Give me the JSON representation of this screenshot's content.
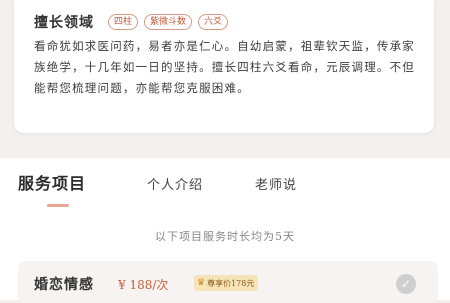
{
  "profile": {
    "expertise_title": "擅长领域",
    "tags": [
      "四柱",
      "紫微斗数",
      "六爻"
    ],
    "bio": "看命犹如求医问药，易者亦是仁心。自幼启蒙，祖辈钦天监，传承家族绝学，十几年如一日的坚持。擅长四柱六爻看命，元辰调理。不但能帮您梳理问题，亦能帮您克服困难。"
  },
  "tabs": [
    {
      "label": "服务项目",
      "active": true
    },
    {
      "label": "个人介绍",
      "active": false
    },
    {
      "label": "老师说",
      "active": false
    }
  ],
  "services": {
    "duration_note": "以下项目服务时长均为5天",
    "items": [
      {
        "name": "婚恋情感",
        "price": "¥ 188/次",
        "member_price": "尊享价178元",
        "selected": false
      }
    ]
  },
  "colors": {
    "accent": "#c5603e",
    "tab_underline": "#e8a58f",
    "badge_bg": "#f6e4b8",
    "page_bg": "#f3f0ee"
  }
}
